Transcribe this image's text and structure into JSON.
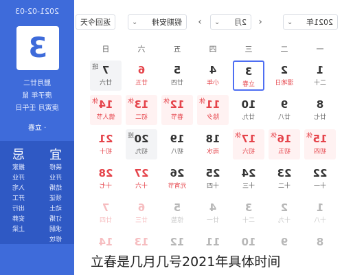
{
  "toolbar": {
    "today_button": "返回今天",
    "holiday_select": "假期安排",
    "month_select": "2月",
    "year_select": "2021年"
  },
  "weekdays": [
    "一",
    "二",
    "三",
    "四",
    "五",
    "六",
    "日"
  ],
  "rows": [
    [
      {
        "n": "1",
        "l": "二十"
      },
      {
        "n": "2",
        "l": "湿地日",
        "fest": true
      },
      {
        "n": "3",
        "l": "立春",
        "fest": true,
        "sel": true
      },
      {
        "n": "4",
        "l": "小年",
        "fest": true
      },
      {
        "n": "5",
        "l": "廿四"
      },
      {
        "n": "6",
        "l": "廿五",
        "red": true
      },
      {
        "n": "7",
        "l": "廿六",
        "work": true,
        "tag": "班"
      }
    ],
    [
      {
        "n": "8",
        "l": "廿七"
      },
      {
        "n": "9",
        "l": "廿八"
      },
      {
        "n": "10",
        "l": "廿九"
      },
      {
        "n": "11",
        "l": "除夕",
        "red": true,
        "hol": true,
        "tag": "休"
      },
      {
        "n": "12",
        "l": "春节",
        "red": true,
        "hol": true,
        "tag": "休"
      },
      {
        "n": "13",
        "l": "初二",
        "red": true,
        "hol": true,
        "tag": "休"
      },
      {
        "n": "14",
        "l": "情人节",
        "red": true,
        "hol": true,
        "tag": "休"
      }
    ],
    [
      {
        "n": "15",
        "l": "初四",
        "red": true,
        "hol": true,
        "tag": "休"
      },
      {
        "n": "16",
        "l": "初五",
        "red": true,
        "hol": true,
        "tag": "休"
      },
      {
        "n": "17",
        "l": "初六",
        "red": true,
        "hol": true,
        "tag": "休"
      },
      {
        "n": "18",
        "l": "雨水",
        "fest": true
      },
      {
        "n": "19",
        "l": "初八"
      },
      {
        "n": "20",
        "l": "初九",
        "work": true,
        "tag": "班"
      },
      {
        "n": "21",
        "l": "初十",
        "red": true
      }
    ],
    [
      {
        "n": "22",
        "l": "十一"
      },
      {
        "n": "23",
        "l": "十二"
      },
      {
        "n": "24",
        "l": "十三"
      },
      {
        "n": "25",
        "l": "十四"
      },
      {
        "n": "26",
        "l": "元宵节",
        "fest": true
      },
      {
        "n": "27",
        "l": "十六",
        "red": true
      },
      {
        "n": "28",
        "l": "十七",
        "red": true
      }
    ],
    [
      {
        "n": "1",
        "l": "十八",
        "dim": true
      },
      {
        "n": "2",
        "l": "十九",
        "dim": true
      },
      {
        "n": "3",
        "l": "二十",
        "dim": true
      },
      {
        "n": "4",
        "l": "廿一",
        "dim": true
      },
      {
        "n": "5",
        "l": "惊蛰",
        "dim": true
      },
      {
        "n": "6",
        "l": "廿三",
        "dim": true,
        "red": true
      },
      {
        "n": "7",
        "l": "廿四",
        "dim": true,
        "red": true
      }
    ],
    [
      {
        "n": "8",
        "l": "",
        "dim": true
      },
      {
        "n": "9",
        "l": "",
        "dim": true
      },
      {
        "n": "10",
        "l": "",
        "dim": true
      },
      {
        "n": "11",
        "l": "",
        "dim": true
      },
      {
        "n": "12",
        "l": "",
        "dim": true
      },
      {
        "n": "13",
        "l": "",
        "dim": true,
        "red": true
      },
      {
        "n": "14",
        "l": "",
        "dim": true,
        "red": true
      }
    ]
  ],
  "side": {
    "date": "2021-02-03",
    "day": "3",
    "lunar": "腊月廿二",
    "ganzhi_year": "庚子年 鼠",
    "ganzhi_day": "庚寅月 壬午日",
    "term": "· 立春",
    "yi_title": "宜",
    "ji_title": "忌",
    "yi": [
      "装修",
      "开业",
      "结婚",
      "领证",
      "动土",
      "订婚",
      "求嗣",
      "修坟"
    ],
    "ji": [
      "搬家",
      "开业",
      "入宅",
      "开工",
      "出行",
      "安葬",
      "上梁"
    ]
  },
  "caption": "立春是几月几号2021年具体时间"
}
